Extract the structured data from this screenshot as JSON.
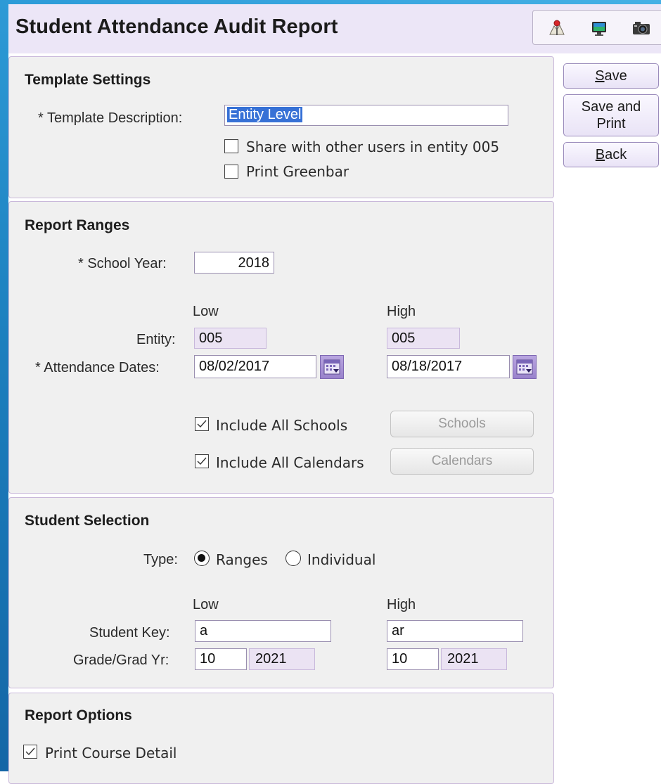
{
  "header": {
    "title": "Student Attendance Audit Report",
    "icons": [
      "map-pin-icon",
      "monitor-icon",
      "camera-icon"
    ]
  },
  "actions": {
    "save": {
      "mnemonic": "S",
      "rest": "ave"
    },
    "save_print_line1": "Save and",
    "save_print_line2": "Print",
    "back": {
      "mnemonic": "B",
      "rest": "ack"
    }
  },
  "template_settings": {
    "title": "Template Settings",
    "description_label": "* Template Description:",
    "description_value": "Entity Level",
    "share_label": "Share with other users in entity 005",
    "share_checked": false,
    "greenbar_label": "Print Greenbar",
    "greenbar_checked": false
  },
  "report_ranges": {
    "title": "Report Ranges",
    "school_year_label": "* School Year:",
    "school_year_value": "2018",
    "low_header": "Low",
    "high_header": "High",
    "entity_label": "Entity:",
    "entity_low": "005",
    "entity_high": "005",
    "att_dates_label": "* Attendance Dates:",
    "att_date_low": "08/02/2017",
    "att_date_high": "08/18/2017",
    "include_schools_label": "Include All Schools",
    "include_schools_checked": true,
    "schools_button": "Schools",
    "include_calendars_label": "Include All Calendars",
    "include_calendars_checked": true,
    "calendars_button": "Calendars"
  },
  "student_selection": {
    "title": "Student Selection",
    "type_label": "Type:",
    "type_ranges": "Ranges",
    "type_individual": "Individual",
    "selected_type": "Ranges",
    "low_header": "Low",
    "high_header": "High",
    "student_key_label": "Student Key:",
    "student_key_low": "a",
    "student_key_high": "ar",
    "grade_label": "Grade/Grad Yr:",
    "grade_low": "10",
    "grad_yr_low": "2021",
    "grade_high": "10",
    "grad_yr_high": "2021"
  },
  "report_options": {
    "title": "Report Options",
    "course_detail_label": "Print Course Detail",
    "course_detail_checked": true
  },
  "colors": {
    "header_bg": "#ece6f7",
    "panel_bg": "#f0f0f0",
    "panel_border": "#c9b8da",
    "selection": "#3771d6",
    "side_accent": "#1c7fbe"
  }
}
